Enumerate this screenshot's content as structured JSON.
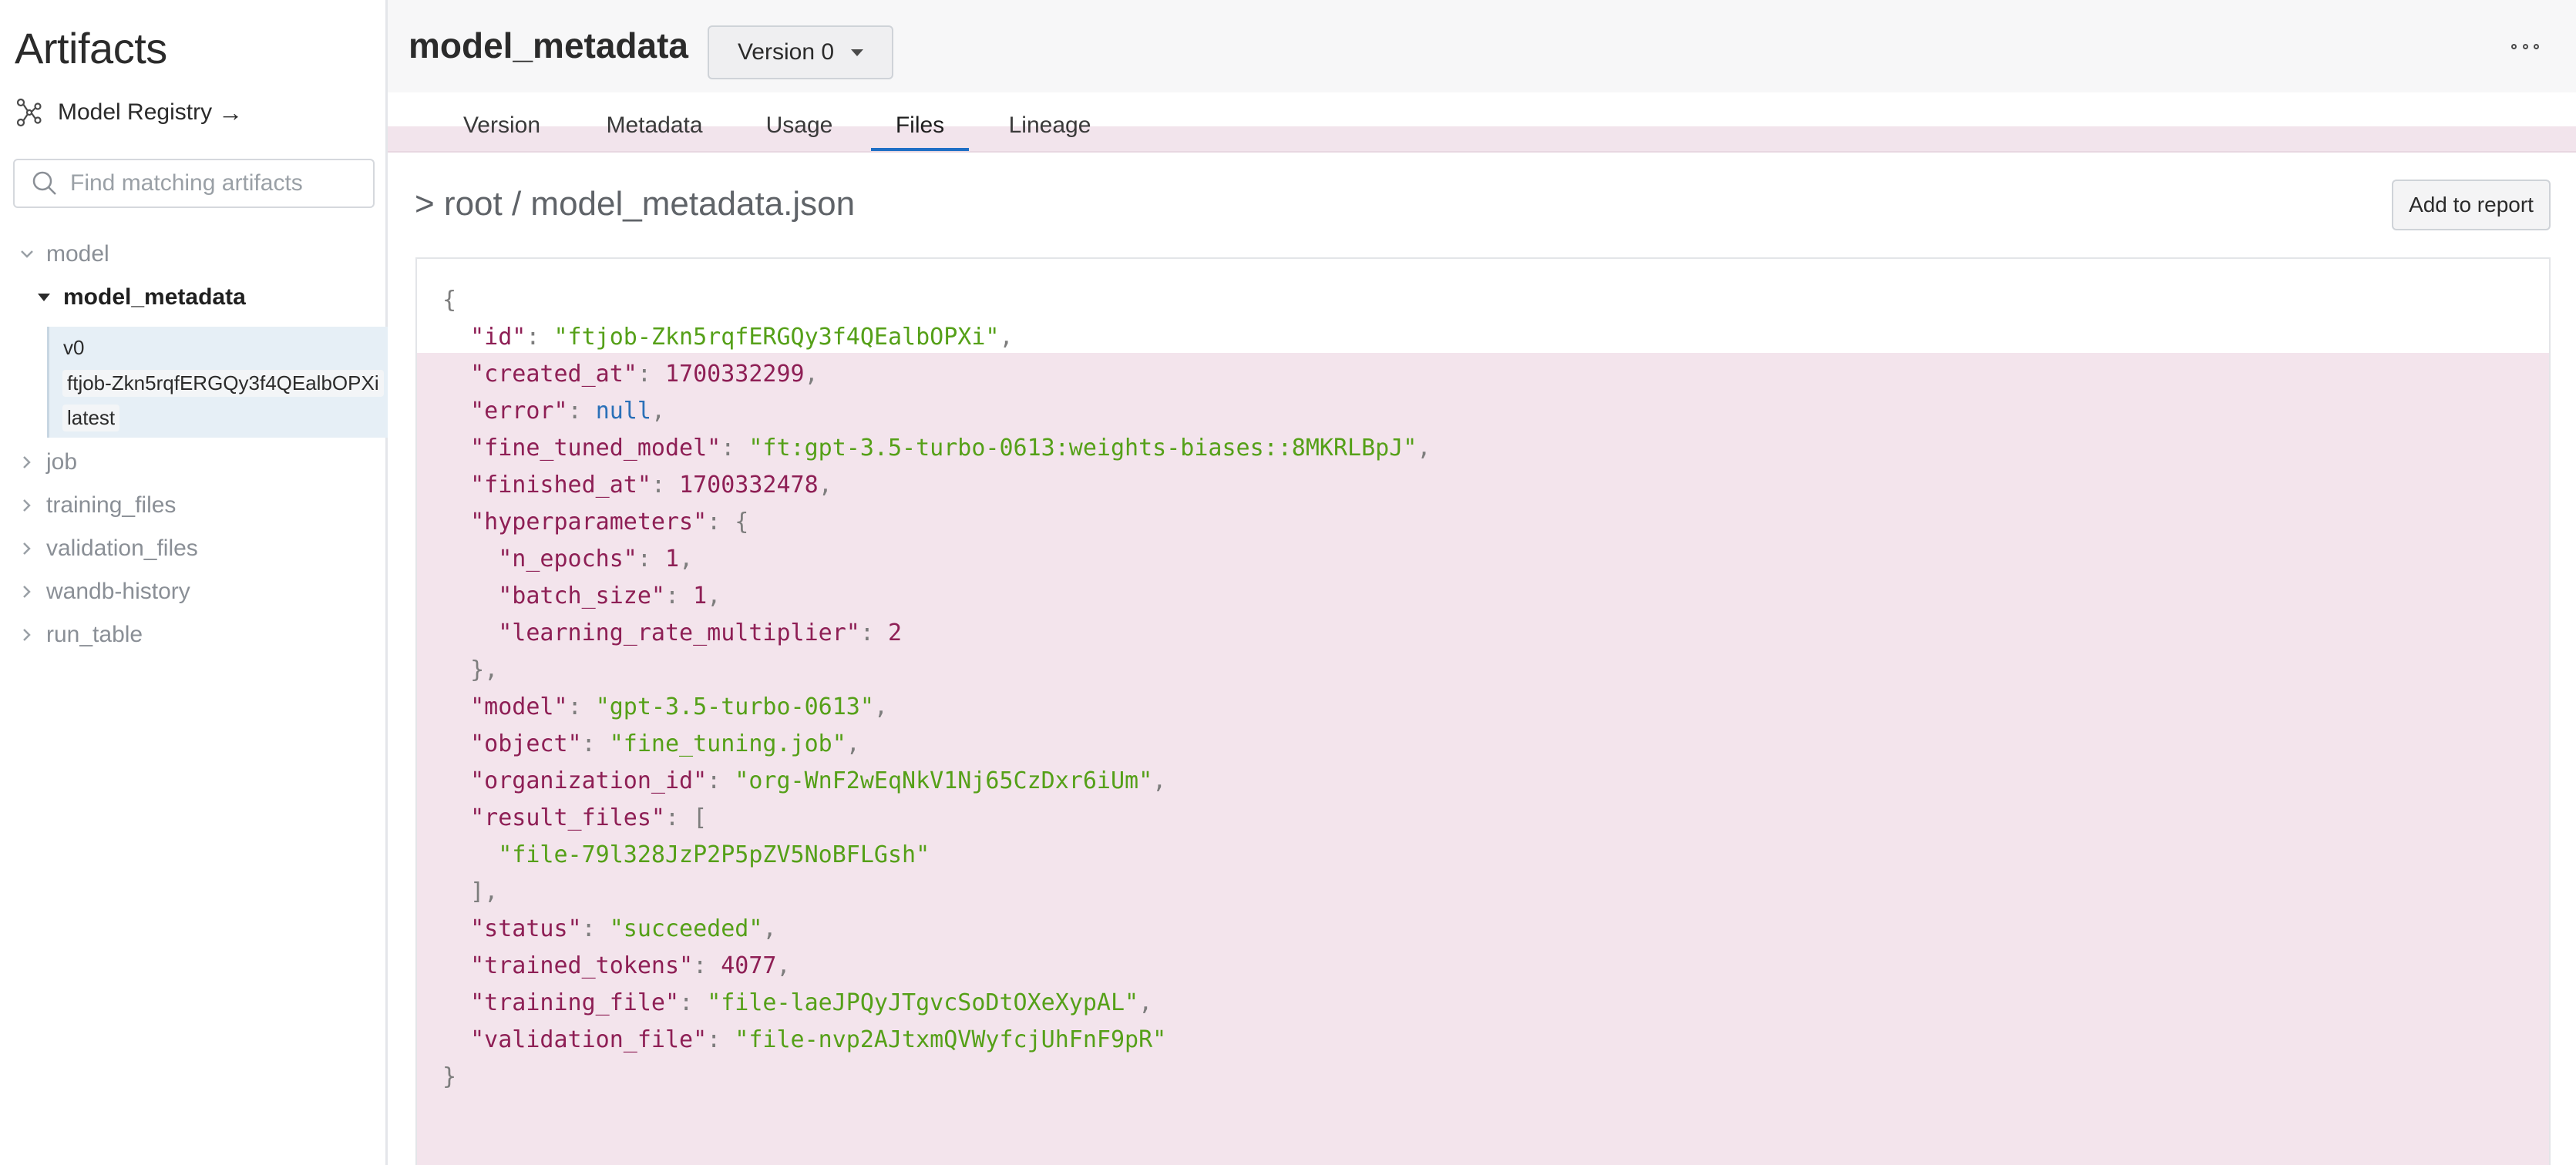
{
  "sidebar": {
    "title": "Artifacts",
    "registry_link": "Model Registry",
    "registry_arrow": "→",
    "search_placeholder": "Find matching artifacts",
    "tree": {
      "model": "model",
      "model_metadata": "model_metadata",
      "version": "v0",
      "aliases": [
        "ftjob-Zkn5rqfERGQy3f4QEalbOPXi",
        "latest"
      ],
      "others": [
        "job",
        "training_files",
        "validation_files",
        "wandb-history",
        "run_table"
      ]
    }
  },
  "header": {
    "title": "model_metadata",
    "version_dropdown": "Version 0",
    "more_icon": "ellipsis-icon"
  },
  "tabs": [
    {
      "label": "Version",
      "active": false
    },
    {
      "label": "Metadata",
      "active": false
    },
    {
      "label": "Usage",
      "active": false
    },
    {
      "label": "Files",
      "active": true
    },
    {
      "label": "Lineage",
      "active": false
    }
  ],
  "content": {
    "breadcrumb": "> root / model_metadata.json",
    "add_report_label": "Add to report"
  },
  "json_file": {
    "id": "ftjob-Zkn5rqfERGQy3f4QEalbOPXi",
    "created_at": 1700332299,
    "error": null,
    "fine_tuned_model": "ft:gpt-3.5-turbo-0613:weights-biases::8MKRLBpJ",
    "finished_at": 1700332478,
    "hyperparameters": {
      "n_epochs": 1,
      "batch_size": 1,
      "learning_rate_multiplier": 2
    },
    "model": "gpt-3.5-turbo-0613",
    "object": "fine_tuning.job",
    "organization_id": "org-WnF2wEqNkV1Nj65CzDxr6iUm",
    "result_files": [
      "file-79l328JzP2P5pZV5NoBFLGsh"
    ],
    "status": "succeeded",
    "trained_tokens": 4077,
    "training_file": "file-laeJPQyJTgvcSoDtOXeXypAL",
    "validation_file": "file-nvp2AJtxmQVWyfcjUhFnF9pR"
  },
  "colors": {
    "accent_tab_underline": "#1f6fc5",
    "json_key": "#8e1f55",
    "json_string": "#55a018",
    "json_null": "#2a70b8",
    "highlight_bg": "#f3e4ec",
    "selected_version_bg": "#e6eff6"
  }
}
